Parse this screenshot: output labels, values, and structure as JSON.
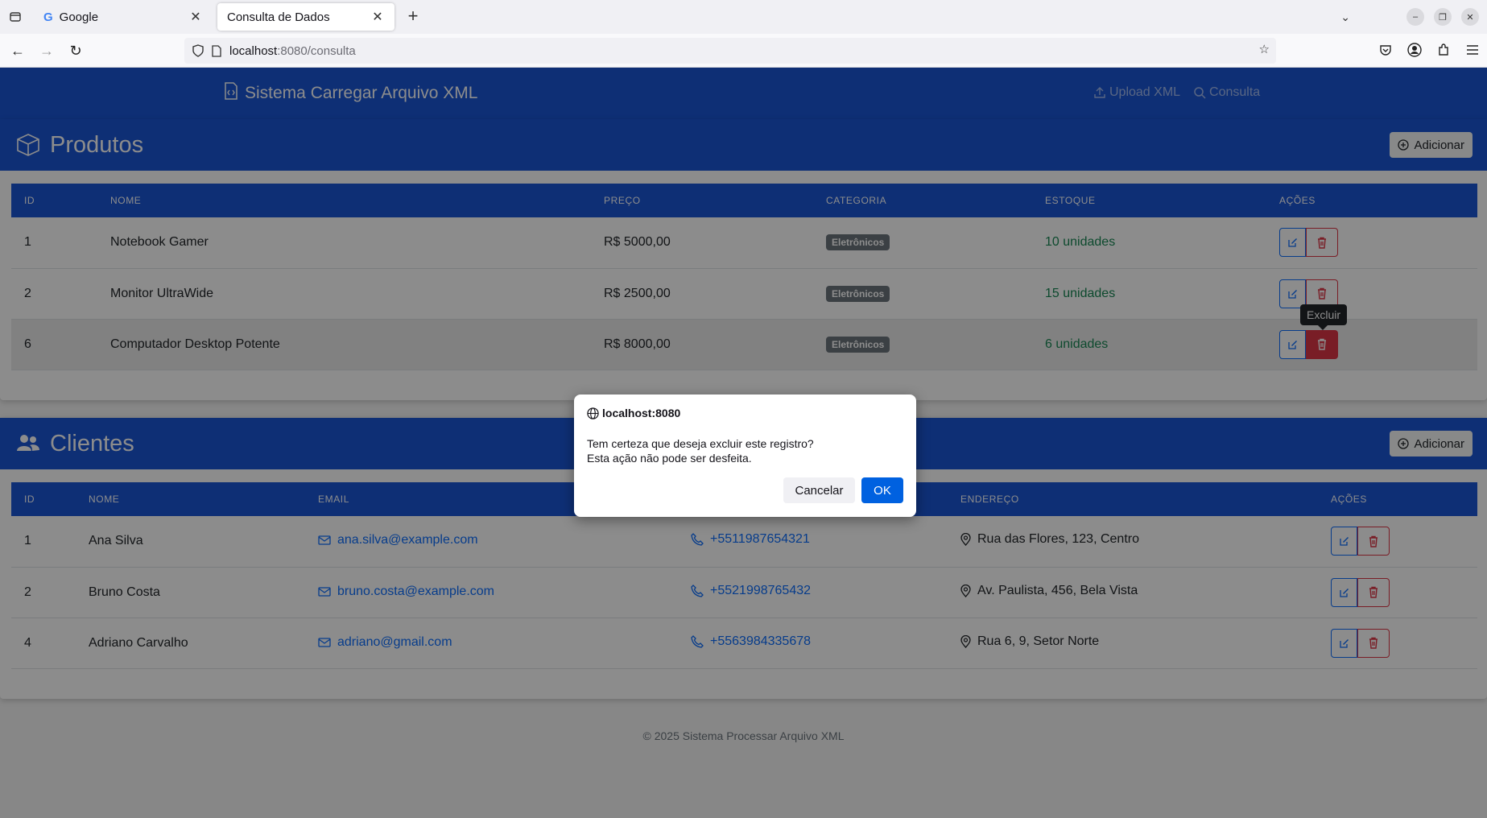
{
  "browser": {
    "tabs": [
      {
        "title": "Google",
        "active": false
      },
      {
        "title": "Consulta de Dados",
        "active": true
      }
    ],
    "url_host": "localhost",
    "url_rest": ":8080/consulta"
  },
  "site": {
    "brand": "Sistema Carregar Arquivo XML",
    "nav": [
      {
        "label": "Upload XML",
        "icon": "upload-icon"
      },
      {
        "label": "Consulta",
        "icon": "search-icon"
      }
    ],
    "footer": "© 2025 Sistema Processar Arquivo XML"
  },
  "produtos": {
    "title": "Produtos",
    "add_label": "Adicionar",
    "columns": [
      "ID",
      "NOME",
      "PREÇO",
      "CATEGORIA",
      "ESTOQUE",
      "AÇÕES"
    ],
    "rows": [
      {
        "id": "1",
        "nome": "Notebook Gamer",
        "preco": "R$ 5000,00",
        "categoria": "Eletrônicos",
        "estoque": "10 unidades"
      },
      {
        "id": "2",
        "nome": "Monitor UltraWide",
        "preco": "R$ 2500,00",
        "categoria": "Eletrônicos",
        "estoque": "15 unidades"
      },
      {
        "id": "6",
        "nome": "Computador Desktop Potente",
        "preco": "R$ 8000,00",
        "categoria": "Eletrônicos",
        "estoque": "6 unidades"
      }
    ],
    "tooltip": "Excluir"
  },
  "clientes": {
    "title": "Clientes",
    "add_label": "Adicionar",
    "columns": [
      "ID",
      "NOME",
      "EMAIL",
      "",
      "ENDEREÇO",
      "AÇÕES"
    ],
    "rows": [
      {
        "id": "1",
        "nome": "Ana Silva",
        "email": "ana.silva@example.com",
        "telefone": "+5511987654321",
        "endereco": "Rua das Flores, 123, Centro"
      },
      {
        "id": "2",
        "nome": "Bruno Costa",
        "email": "bruno.costa@example.com",
        "telefone": "+5521998765432",
        "endereco": "Av. Paulista, 456, Bela Vista"
      },
      {
        "id": "4",
        "nome": "Adriano Carvalho",
        "email": "adriano@gmail.com",
        "telefone": "+5563984335678",
        "endereco": "Rua 6, 9, Setor Norte"
      }
    ]
  },
  "dialog": {
    "origin": "localhost:8080",
    "message_line1": "Tem certeza que deseja excluir este registro?",
    "message_line2": "Esta ação não pode ser desfeita.",
    "cancel_label": "Cancelar",
    "ok_label": "OK"
  },
  "colors": {
    "primary": "#1a56d6",
    "danger": "#dc3545",
    "success": "#198754",
    "link": "#0d6efd"
  }
}
